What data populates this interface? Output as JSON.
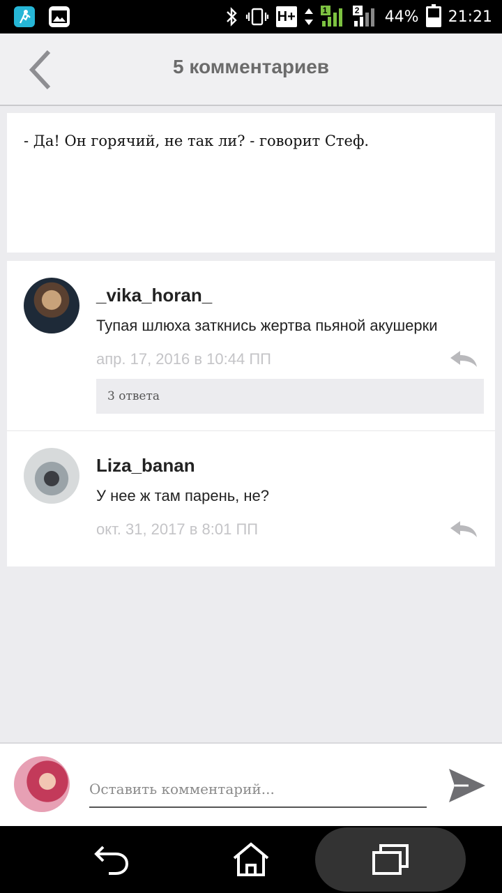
{
  "status_bar": {
    "battery_percent_text": "44%",
    "battery_level": 0.44,
    "time": "21:21",
    "network_badge": "H+",
    "sim1_label": "1",
    "sim2_label": "2",
    "icons": [
      "fitness-app-icon",
      "gallery-icon",
      "bluetooth-icon",
      "vibrate-icon",
      "network-h-plus-icon",
      "signal-sim1-icon",
      "signal-sim2-icon",
      "battery-icon"
    ]
  },
  "header": {
    "title": "5 комментариев",
    "back_icon": "chevron-left-icon"
  },
  "post": {
    "text": "- Да! Он горячий, не так ли? - говорит Стеф."
  },
  "comments": [
    {
      "username": "_vika_horan_",
      "text": "Тупая шлюха заткнись жертва пьяной акушерки",
      "date": "апр. 17, 2016 в 10:44 ПП",
      "replies_label": "3 ответа",
      "reply_icon": "reply-arrow-icon"
    },
    {
      "username": "Liza_banan",
      "text": "У нее ж там парень, не?",
      "date": "окт. 31, 2017 в 8:01 ПП",
      "reply_icon": "reply-arrow-icon"
    }
  ],
  "composer": {
    "placeholder": "Оставить комментарий...",
    "value": "",
    "send_icon": "send-icon"
  },
  "colors": {
    "background": "#ececef",
    "header_title": "#6b6b6b",
    "date_text": "#c4c4c7",
    "fitness_app": "#26b6d6"
  }
}
